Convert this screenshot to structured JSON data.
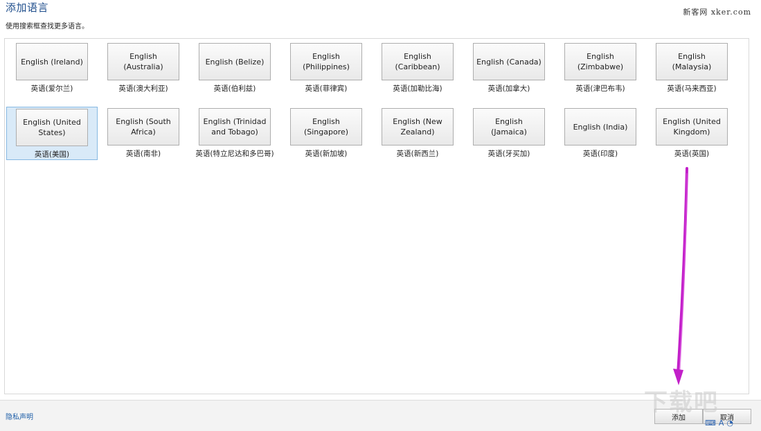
{
  "dialog": {
    "title": "添加语言",
    "subtitle": "使用搜索框查找更多语言。"
  },
  "watermark": {
    "top_right": "新客网 xker.com",
    "logo": "下载吧"
  },
  "languages": [
    {
      "en": "English (Ireland)",
      "cn": "英语(爱尔兰)",
      "selected": false
    },
    {
      "en": "English (Australia)",
      "cn": "英语(澳大利亚)",
      "selected": false
    },
    {
      "en": "English (Belize)",
      "cn": "英语(伯利兹)",
      "selected": false
    },
    {
      "en": "English (Philippines)",
      "cn": "英语(菲律宾)",
      "selected": false
    },
    {
      "en": "English (Caribbean)",
      "cn": "英语(加勒比海)",
      "selected": false
    },
    {
      "en": "English (Canada)",
      "cn": "英语(加拿大)",
      "selected": false
    },
    {
      "en": "English (Zimbabwe)",
      "cn": "英语(津巴布韦)",
      "selected": false
    },
    {
      "en": "English (Malaysia)",
      "cn": "英语(马来西亚)",
      "selected": false
    },
    {
      "en": "English (United States)",
      "cn": "英语(美国)",
      "selected": true
    },
    {
      "en": "English (South Africa)",
      "cn": "英语(南非)",
      "selected": false
    },
    {
      "en": "English (Trinidad and Tobago)",
      "cn": "英语(特立尼达和多巴哥)",
      "selected": false
    },
    {
      "en": "English (Singapore)",
      "cn": "英语(新加坡)",
      "selected": false
    },
    {
      "en": "English (New Zealand)",
      "cn": "英语(新西兰)",
      "selected": false
    },
    {
      "en": "English (Jamaica)",
      "cn": "英语(牙买加)",
      "selected": false
    },
    {
      "en": "English (India)",
      "cn": "英语(印度)",
      "selected": false
    },
    {
      "en": "English (United Kingdom)",
      "cn": "英语(英国)",
      "selected": false
    }
  ],
  "footer": {
    "privacy_link": "隐私声明",
    "add_button": "添加",
    "cancel_button": "取消"
  },
  "colors": {
    "selected_bg": "#d9eaf8",
    "selected_border": "#86b8e2",
    "annotation_arrow": "#c21fc9",
    "title_blue": "#1f4e8c"
  }
}
